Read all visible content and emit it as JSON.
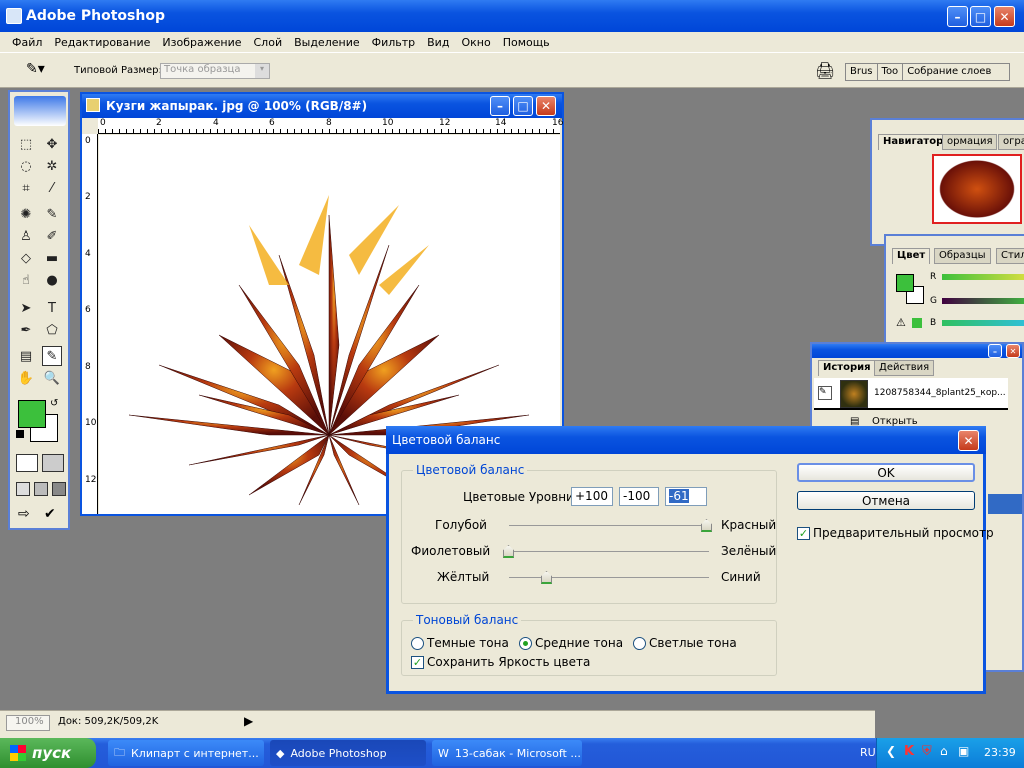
{
  "app": {
    "title": "Adobe Photoshop"
  },
  "menu": [
    "Файл",
    "Редактирование",
    "Изображение",
    "Слой",
    "Выделение",
    "Фильтр",
    "Вид",
    "Окно",
    "Помощь"
  ],
  "options": {
    "size_label": "Типовой Размер:",
    "size_value": "Точка образца"
  },
  "palette_well": [
    "Brus",
    "Too",
    "Собрание слоев"
  ],
  "document": {
    "title": "Кузги жапырак. jpg @ 100% (RGB/8#)",
    "ruler_h": [
      "0",
      "2",
      "4",
      "6",
      "8",
      "10",
      "12",
      "14",
      "16"
    ],
    "ruler_v": [
      "0",
      "2",
      "4",
      "6",
      "8",
      "10",
      "12"
    ]
  },
  "navigator": {
    "tabs": [
      "Навигатор",
      "ормация",
      "огра"
    ]
  },
  "color_panel": {
    "tabs": [
      "Цвет",
      "Образцы",
      "Стил"
    ],
    "channels": [
      "R",
      "G",
      "B"
    ],
    "fg_color": "#3cc03c"
  },
  "history": {
    "tabs": [
      "История",
      "Действия"
    ],
    "snapshot": "1208758344_8plant25_кор...",
    "items": [
      "Открыть"
    ]
  },
  "dialog": {
    "title": "Цветовой баланс",
    "group1": "Цветовой баланс",
    "levels_label": "Цветовые Уровни:",
    "levels": [
      "+100",
      "-100",
      "-61"
    ],
    "sliders": [
      {
        "left": "Голубой",
        "right": "Красный",
        "value": 100
      },
      {
        "left": "Фиолетовый",
        "right": "Зелёный",
        "value": -100
      },
      {
        "left": "Жёлтый",
        "right": "Синий",
        "value": -61
      }
    ],
    "group2": "Тоновый баланс",
    "tones": [
      "Темные тона",
      "Средние тона",
      "Светлые тона"
    ],
    "tone_selected": 1,
    "preserve": "Сохранить Яркость цвета",
    "ok": "OK",
    "cancel": "Отмена",
    "preview": "Предварительный просмотр"
  },
  "status": {
    "zoom": "100%",
    "doc": "Док: 509,2K/509,2K"
  },
  "taskbar": {
    "start": "пуск",
    "items": [
      "Клипарт с интернет...",
      "Adobe Photoshop",
      "13-сабак - Microsoft ..."
    ],
    "lang": "RU",
    "time": "23:39"
  }
}
